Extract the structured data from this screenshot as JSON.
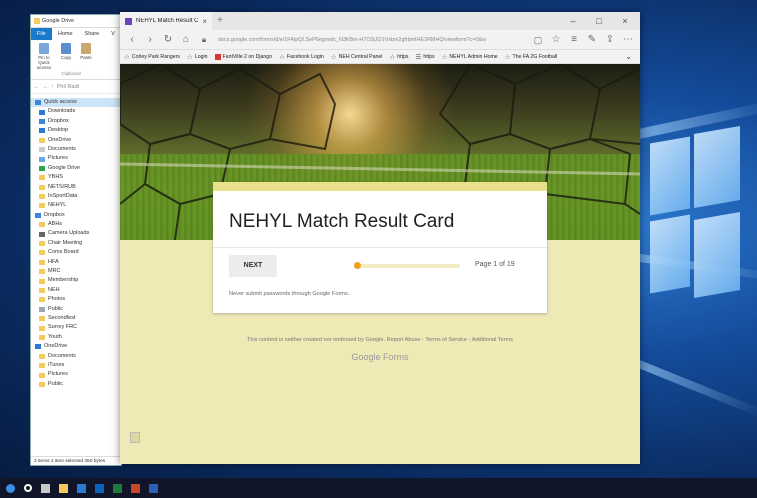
{
  "explorer": {
    "title": "Google Drive",
    "ribbon_tabs": [
      "File",
      "Home",
      "Share",
      "V"
    ],
    "ribbon_buttons": [
      "Pin to Quick access",
      "Copy",
      "Paste"
    ],
    "clipboard_label": "Clipboard",
    "address": "Phil Radt",
    "tree": [
      {
        "label": "Quick access",
        "icon": "star-icon",
        "section": true,
        "selected": true
      },
      {
        "label": "Downloads",
        "icon": "download-icon"
      },
      {
        "label": "Dropbox",
        "icon": "dropbox-icon"
      },
      {
        "label": "Desktop",
        "icon": "desktop-icon"
      },
      {
        "label": "OneDrive",
        "icon": "folder-icon"
      },
      {
        "label": "Documents",
        "icon": "documents-icon"
      },
      {
        "label": "Pictures",
        "icon": "pictures-icon"
      },
      {
        "label": "Google Drive",
        "icon": "google-drive-icon"
      },
      {
        "label": "YBHS",
        "icon": "folder-icon"
      },
      {
        "label": "NETS/RUB",
        "icon": "folder-icon"
      },
      {
        "label": "InSportData",
        "icon": "folder-icon"
      },
      {
        "label": "NEHYL",
        "icon": "folder-icon"
      },
      {
        "label": "Dropbox",
        "icon": "dropbox-icon",
        "section": true
      },
      {
        "label": "ABHs",
        "icon": "folder-icon"
      },
      {
        "label": "Camera Uploads",
        "icon": "camera-icon"
      },
      {
        "label": "Chair Meeting",
        "icon": "folder-icon"
      },
      {
        "label": "Coms Board",
        "icon": "folder-icon"
      },
      {
        "label": "HFA",
        "icon": "folder-icon"
      },
      {
        "label": "MRC",
        "icon": "folder-icon"
      },
      {
        "label": "Membership",
        "icon": "folder-icon"
      },
      {
        "label": "NEH",
        "icon": "folder-icon"
      },
      {
        "label": "Photos",
        "icon": "folder-icon"
      },
      {
        "label": "Public",
        "icon": "public-icon"
      },
      {
        "label": "Secondfest",
        "icon": "folder-icon"
      },
      {
        "label": "Surrey FRC",
        "icon": "folder-icon"
      },
      {
        "label": "Youth",
        "icon": "folder-icon"
      },
      {
        "label": "OneDrive",
        "icon": "onedrive-icon",
        "section": true
      },
      {
        "label": "Documents",
        "icon": "folder-icon"
      },
      {
        "label": "iTunes",
        "icon": "folder-icon"
      },
      {
        "label": "Pictures",
        "icon": "folder-icon"
      },
      {
        "label": "Public",
        "icon": "folder-icon"
      }
    ],
    "status": "3 items   1 item selected  350 bytes"
  },
  "browser": {
    "tab_title": "NEHYL Match Result Ca",
    "url": "docs.google.com/forms/d/e/1FAIpQLSeP6egnvdc_N3KBm-H7O3jJO1Vsbm2gfrbmtHE3RMHQ/viewform?c=0&w",
    "favorites": [
      {
        "label": "Corley Park Rangers",
        "icon": "star-icon"
      },
      {
        "label": "Login",
        "icon": "star-icon"
      },
      {
        "label": "FantVille 2 on Django",
        "icon": "red-square-icon"
      },
      {
        "label": "Facebook Login",
        "icon": "star-icon"
      },
      {
        "label": "NEH Central Panel",
        "icon": "star-icon"
      },
      {
        "label": "https",
        "icon": "star-icon"
      },
      {
        "label": "https",
        "icon": "bars-icon"
      },
      {
        "label": "NEHYL Admin Home",
        "icon": "star-icon"
      },
      {
        "label": "The FA 2G Football",
        "icon": "star-icon"
      }
    ]
  },
  "form": {
    "title": "NEHYL Match Result Card",
    "next_label": "NEXT",
    "progress": 0.05,
    "page_indicator": "Page 1 of 19",
    "warning": "Never submit passwords through Google Forms.",
    "footer": "This content is neither created nor endorsed by Google. Report Abuse - Terms of Service - Additional Terms",
    "brand": "Google Forms"
  },
  "colors": {
    "form_background": "#efe9b6",
    "card_accent": "#e8e08a",
    "progress": "#f0a020",
    "explorer_file_tab": "#1979ca"
  }
}
